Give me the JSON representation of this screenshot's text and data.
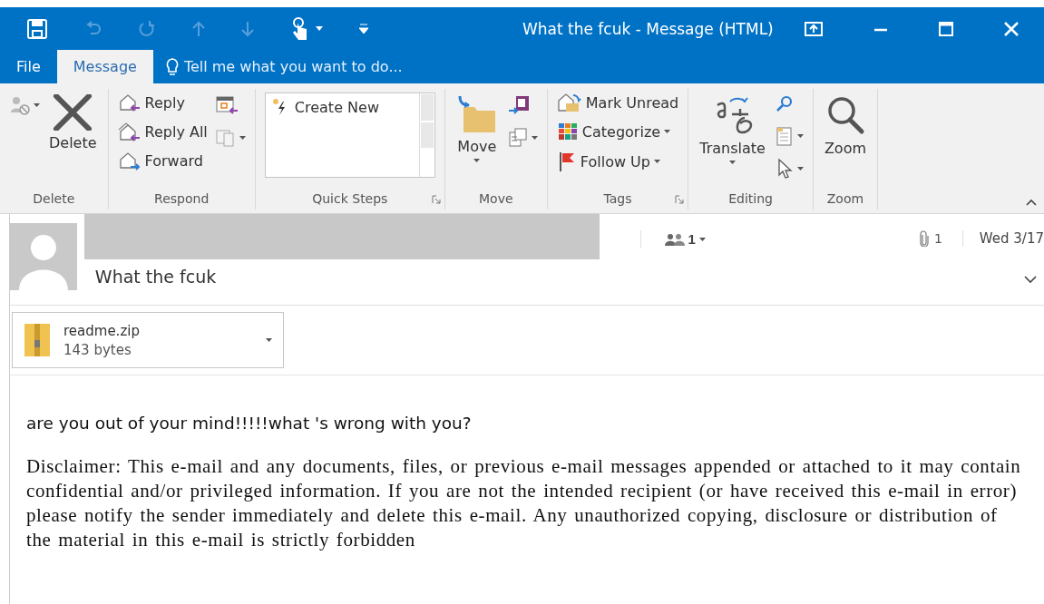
{
  "window": {
    "title": "What the fcuk - Message (HTML)"
  },
  "tabs": [
    {
      "label": "File",
      "selected": false
    },
    {
      "label": "Message",
      "selected": true
    }
  ],
  "tell_me": {
    "placeholder": "Tell me what you want to do..."
  },
  "ribbon": {
    "groups": [
      {
        "label": "Delete",
        "columns": [
          [
            {
              "kind": "icon",
              "dropdown": true
            }
          ],
          [
            {
              "kind": "large",
              "label": "Delete",
              "dropdown": false
            }
          ]
        ]
      },
      {
        "label": "Respond",
        "columns": [
          [
            {
              "kind": "small",
              "label": "Reply",
              "dropdown": false
            },
            {
              "kind": "small",
              "label": "Reply All",
              "dropdown": false
            },
            {
              "kind": "small",
              "label": "Forward",
              "dropdown": false
            }
          ],
          [
            {
              "kind": "icon",
              "dropdown": false
            },
            {
              "kind": "icon",
              "dropdown": true
            }
          ]
        ]
      },
      {
        "label": "Quick Steps",
        "launcher": true,
        "columns": [
          [
            {
              "kind": "gallery",
              "label": "Create New"
            }
          ]
        ]
      },
      {
        "label": "Move",
        "columns": [
          [
            {
              "kind": "large",
              "label": "Move",
              "dropdown": true
            }
          ],
          [
            {
              "kind": "icon",
              "dropdown": false
            },
            {
              "kind": "icon",
              "dropdown": true
            }
          ]
        ]
      },
      {
        "label": "Tags",
        "launcher": true,
        "columns": [
          [
            {
              "kind": "small",
              "label": "Mark Unread",
              "dropdown": false
            },
            {
              "kind": "small",
              "label": "Categorize",
              "dropdown": true
            },
            {
              "kind": "small",
              "label": "Follow Up",
              "dropdown": true
            }
          ]
        ]
      },
      {
        "label": "Editing",
        "columns": [
          [
            {
              "kind": "large",
              "label": "Translate",
              "dropdown": true
            }
          ],
          [
            {
              "kind": "icon",
              "dropdown": false
            },
            {
              "kind": "icon",
              "dropdown": true
            },
            {
              "kind": "icon",
              "dropdown": true
            }
          ]
        ]
      },
      {
        "label": "Zoom",
        "columns": [
          [
            {
              "kind": "large",
              "label": "Zoom",
              "dropdown": false
            }
          ]
        ]
      }
    ]
  },
  "message": {
    "recipients_count": "1",
    "attachments_count": "1",
    "date": "Wed 3/17",
    "subject": "What the fcuk",
    "attachments": [
      {
        "name": "readme.zip",
        "size": "143 bytes"
      }
    ],
    "body": [
      {
        "kind": "sans",
        "text": "are you out of your mind!!!!!what 's wrong with you?"
      },
      {
        "kind": "serif",
        "text": "Disclaimer: This e-mail and any documents, files, or previous e-mail messages appended or attached to it may contain confidential and/or privileged information. If you are not the intended recipient (or have received this e-mail in error) please notify the sender immediately and delete this e-mail. Any unauthorized copying, disclosure or distribution of the material in this e-mail is strictly forbidden"
      }
    ]
  }
}
